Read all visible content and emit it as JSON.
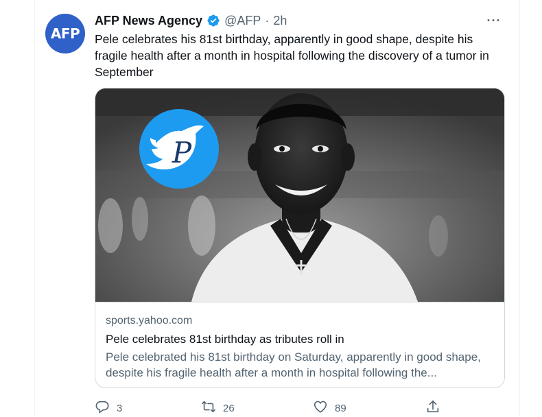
{
  "tweet": {
    "avatar_text": "AFP",
    "display_name": "AFP News Agency",
    "handle": "@AFP",
    "separator": "·",
    "time": "2h",
    "more_label": "···",
    "text": "Pele celebrates his 81st birthday, apparently in good shape, despite his fragile health after a month in hospital following the discovery of a tumor in September"
  },
  "card": {
    "domain": "sports.yahoo.com",
    "title": "Pele celebrates 81st birthday as tributes roll in",
    "description": "Pele celebrated his 81st birthday on Saturday, apparently in good shape, despite his fragile health after a month in hospital following the..."
  },
  "actions": {
    "reply_count": "3",
    "retweet_count": "26",
    "like_count": "89"
  },
  "icons": {
    "verified": "verified-badge-icon",
    "reply": "reply-icon",
    "retweet": "retweet-icon",
    "like": "heart-icon",
    "share": "share-icon",
    "more": "more-horizontal-icon",
    "watermark": "twitter-bird-logo"
  },
  "colors": {
    "avatar_bg": "#2f61c8",
    "verified": "#1d9bf0",
    "secondary_text": "#536471",
    "watermark_bg": "#1d9bf0"
  }
}
